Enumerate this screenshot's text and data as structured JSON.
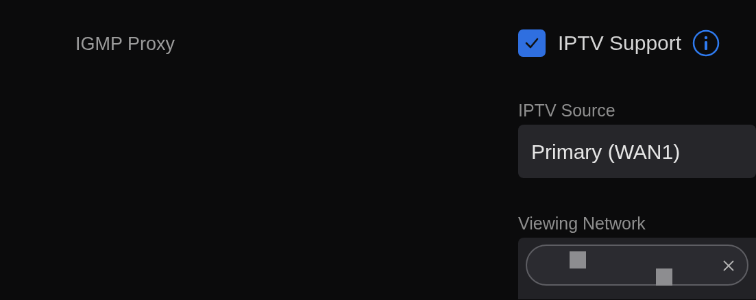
{
  "section_label": "IGMP Proxy",
  "iptv_support": {
    "label": "IPTV Support",
    "checked": true
  },
  "iptv_source": {
    "label": "IPTV Source",
    "value": "Primary (WAN1)"
  },
  "viewing_network": {
    "label": "Viewing Network",
    "chips": [
      {
        "kind": "redacted"
      }
    ]
  }
}
